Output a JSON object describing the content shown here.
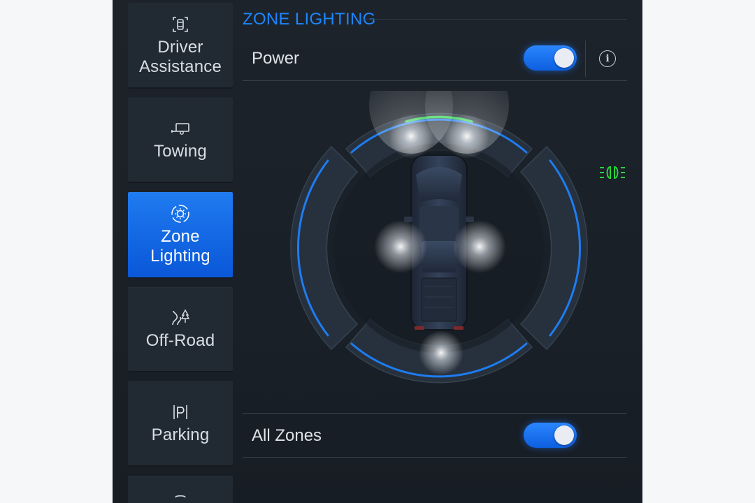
{
  "sidebar": {
    "items": [
      {
        "label": "Driver\nAssistance",
        "icon": "driver-assistance-icon",
        "active": false
      },
      {
        "label": "Towing",
        "icon": "trailer-icon",
        "active": false
      },
      {
        "label": "Zone\nLighting",
        "icon": "zone-lighting-icon",
        "active": true
      },
      {
        "label": "Off-Road",
        "icon": "off-road-icon",
        "active": false
      },
      {
        "label": "Parking",
        "icon": "parking-icon",
        "active": false
      }
    ]
  },
  "main": {
    "title": "ZONE LIGHTING",
    "power": {
      "label": "Power",
      "on": true
    },
    "all_zones": {
      "label": "All Zones",
      "on": true
    }
  },
  "zones": {
    "front": true,
    "rear": true,
    "left": true,
    "right": true
  },
  "colors": {
    "accent": "#1e86ff",
    "active_tile": "#0a57d8",
    "zone_ring": "#1e7cf0",
    "front_indicator": "#2fd14a",
    "headlight_icon": "#29d33a",
    "background": "#1c232b"
  }
}
